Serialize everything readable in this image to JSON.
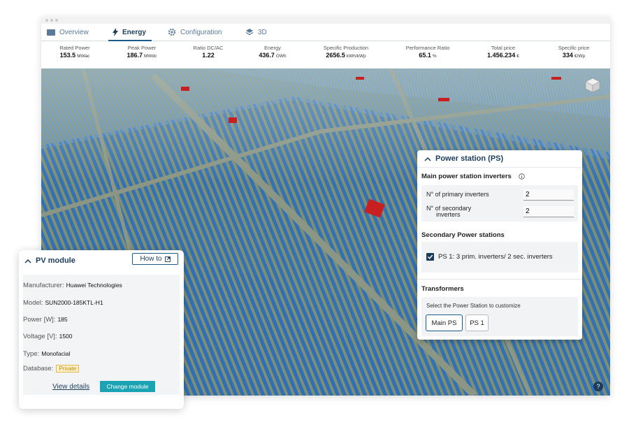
{
  "tabs": [
    {
      "label": "Overview",
      "icon": "folder-icon"
    },
    {
      "label": "Energy",
      "icon": "lightning-icon"
    },
    {
      "label": "Configuration",
      "icon": "gear-icon"
    },
    {
      "label": "3D",
      "icon": "layers-icon"
    }
  ],
  "active_tab": "Energy",
  "metrics": [
    {
      "label": "Rated Power",
      "value": "153.5",
      "unit": "MWac"
    },
    {
      "label": "Peak Power",
      "value": "186.7",
      "unit": "MWdc"
    },
    {
      "label": "Ratio DC/AC",
      "value": "1.22",
      "unit": ""
    },
    {
      "label": "Energy",
      "value": "436.7",
      "unit": "GWh"
    },
    {
      "label": "Specific Production",
      "value": "2656.5",
      "unit": "kWh/kWp"
    },
    {
      "label": "Performance Ratio",
      "value": "65.1",
      "unit": "%"
    },
    {
      "label": "Total price",
      "value": "1.456.234",
      "unit": "€"
    },
    {
      "label": "Specific price",
      "value": "334",
      "unit": "€/Wp"
    }
  ],
  "power_station": {
    "title": "Power station (PS)",
    "main_inverters_title": "Main power station inverters",
    "primary_label": "N° of primary inverters",
    "primary_value": "2",
    "secondary_label_1": "N° of secondary",
    "secondary_label_2": "inverters",
    "secondary_value": "2",
    "secondary_ps_title": "Secondary Power stations",
    "ps1_label": "PS 1: 3 prim. inverters/ 2 sec. inverters",
    "ps1_checked": true,
    "transformers_title": "Transformers",
    "transformers_hint": "Select the Power Station to customize",
    "btn_main": "Main PS",
    "btn_ps1": "PS 1"
  },
  "pv_module": {
    "title": "PV module",
    "how_to": "How to",
    "manufacturer_label": "Manufacturer:",
    "manufacturer_value": "Huawei Technologies",
    "model_label": "Model:",
    "model_value": "SUN2000-185KTL-H1",
    "power_label": "Power [W]:",
    "power_value": "185",
    "voltage_label": "Voltage [V]:",
    "voltage_value": "1500",
    "type_label": "Type:",
    "type_value": "Monofacial",
    "database_label": "Database:",
    "database_value": "Private",
    "view_details": "View details",
    "change_module": "Change module"
  },
  "help_symbol": "?",
  "colors": {
    "accent": "#1c3c5c",
    "teal_button": "#1aa3b3",
    "panel_blue": "#2f6fb8",
    "ground": "#7e8f73"
  }
}
